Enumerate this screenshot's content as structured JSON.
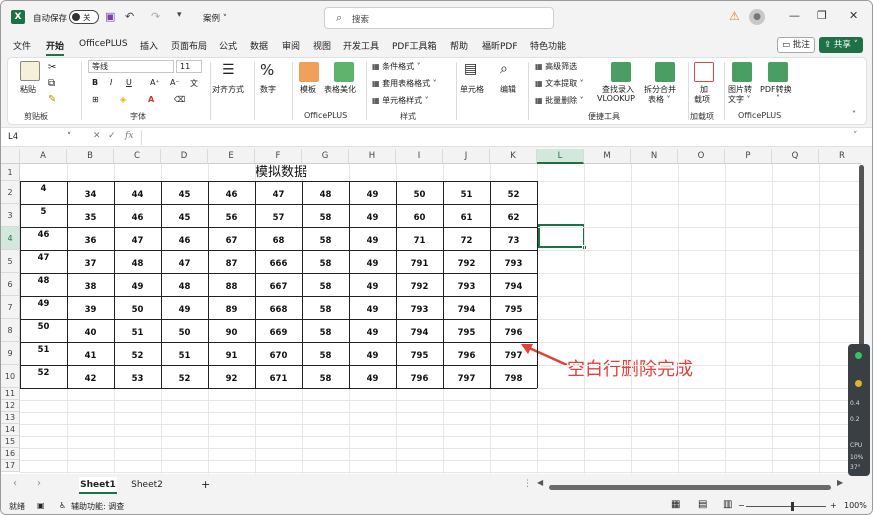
{
  "titlebar": {
    "autosave_label": "自动保存",
    "autosave_state": "关",
    "filename": "案例",
    "search_placeholder": "搜索",
    "warn_glyph": "⚠",
    "minimize": "—",
    "restore": "❐",
    "close": "✕"
  },
  "menu": {
    "items": [
      "文件",
      "开始",
      "OfficePLUS",
      "插入",
      "页面布局",
      "公式",
      "数据",
      "审阅",
      "视图",
      "开发工具",
      "PDF工具箱",
      "帮助",
      "福昕PDF",
      "特色功能"
    ],
    "active": "开始",
    "comment": "批注",
    "share": "共享"
  },
  "ribbon": {
    "paste": "粘贴",
    "clipboard_group": "剪贴板",
    "font_name": "等线",
    "font_size": "11",
    "font_group": "字体",
    "align": "对齐方式",
    "number": "数字",
    "template": "模板",
    "beautify": "表格美化",
    "officeplus_group": "OfficePLUS",
    "cond_format": "条件格式",
    "table_format": "套用表格格式",
    "cell_style": "单元格样式",
    "style_group": "样式",
    "cells": "单元格",
    "edit": "编辑",
    "adv_filter": "高级筛选",
    "text_extract": "文本提取",
    "batch_delete": "批量删除",
    "lookup_line1": "查找录入",
    "lookup_line2": "VLOOKUP",
    "split_line1": "拆分合并",
    "split_line2": "表格",
    "tools_group": "便捷工具",
    "addin_line1": "加",
    "addin_line2": "载项",
    "addin_group": "加载项",
    "img2txt_line1": "图片转",
    "img2txt_line2": "文字",
    "pdf_line1": "PDF转换",
    "pdf_line2": "",
    "officeplus2_group": "OfficePLUS"
  },
  "formula": {
    "cell_ref": "L4",
    "fx": "fx",
    "cancel": "✕",
    "confirm": "✓"
  },
  "grid": {
    "columns": [
      "A",
      "B",
      "C",
      "D",
      "E",
      "F",
      "G",
      "H",
      "I",
      "J",
      "K",
      "L",
      "M",
      "N",
      "O",
      "P",
      "Q",
      "R"
    ],
    "rows": [
      "1",
      "2",
      "3",
      "4",
      "5",
      "6",
      "7",
      "8",
      "9",
      "10",
      "11",
      "12",
      "13",
      "14",
      "15",
      "16",
      "17"
    ],
    "title": "模拟数据",
    "data": [
      [
        "4",
        "34",
        "44",
        "45",
        "46",
        "47",
        "48",
        "49",
        "50",
        "51",
        "52"
      ],
      [
        "5",
        "35",
        "46",
        "45",
        "56",
        "57",
        "58",
        "49",
        "60",
        "61",
        "62"
      ],
      [
        "46",
        "36",
        "47",
        "46",
        "67",
        "68",
        "58",
        "49",
        "71",
        "72",
        "73"
      ],
      [
        "47",
        "37",
        "48",
        "47",
        "87",
        "666",
        "58",
        "49",
        "791",
        "792",
        "793"
      ],
      [
        "48",
        "38",
        "49",
        "48",
        "88",
        "667",
        "58",
        "49",
        "792",
        "793",
        "794"
      ],
      [
        "49",
        "39",
        "50",
        "49",
        "89",
        "668",
        "58",
        "49",
        "793",
        "794",
        "795"
      ],
      [
        "50",
        "40",
        "51",
        "50",
        "90",
        "669",
        "58",
        "49",
        "794",
        "795",
        "796"
      ],
      [
        "51",
        "41",
        "52",
        "51",
        "91",
        "670",
        "58",
        "49",
        "795",
        "796",
        "797"
      ],
      [
        "52",
        "42",
        "53",
        "52",
        "92",
        "671",
        "58",
        "49",
        "796",
        "797",
        "798"
      ]
    ],
    "annotation": "空白行删除完成"
  },
  "sheets": {
    "tabs": [
      "Sheet1",
      "Sheet2"
    ],
    "active": "Sheet1",
    "add": "+"
  },
  "status": {
    "ready": "就绪",
    "accessibility": "辅助功能: 调查",
    "zoom": "100%"
  },
  "widget": {
    "line1": "0.4",
    "line2": "0.2",
    "line3": "CPU",
    "line4": "10%",
    "line5": "37°"
  },
  "colors": {
    "accent": "#1e7145",
    "annotation": "#e0413a"
  }
}
